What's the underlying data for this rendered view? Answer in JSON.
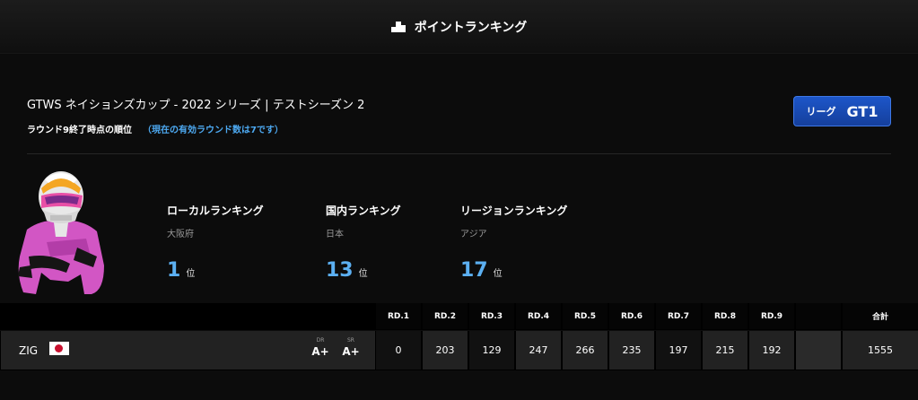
{
  "header": {
    "title": "ポイントランキング",
    "icon": "podium-icon"
  },
  "event": {
    "title": "GTWS ネイションズカップ - 2022 シリーズ | テストシーズン 2",
    "round_status": "ラウンド9終了時点の順位",
    "valid_rounds": "（現在の有効ラウンド数は7です）"
  },
  "league": {
    "label": "リーグ",
    "value": "GT1"
  },
  "rankings": [
    {
      "title": "ローカルランキング",
      "region": "大阪府",
      "rank": "1",
      "unit": "位"
    },
    {
      "title": "国内ランキング",
      "region": "日本",
      "rank": "13",
      "unit": "位"
    },
    {
      "title": "リージョンランキング",
      "region": "アジア",
      "rank": "17",
      "unit": "位"
    }
  ],
  "table": {
    "headers": [
      "RD.1",
      "RD.2",
      "RD.3",
      "RD.4",
      "RD.5",
      "RD.6",
      "RD.7",
      "RD.8",
      "RD.9",
      "",
      "合計"
    ],
    "row": {
      "name": "ZIG",
      "flag": "japan-flag",
      "dr_label": "DR",
      "dr_value": "A+",
      "sr_label": "SR",
      "sr_value": "A+",
      "scores": [
        "0",
        "203",
        "129",
        "247",
        "266",
        "235",
        "197",
        "215",
        "192",
        ""
      ],
      "total": "1555"
    }
  },
  "colors": {
    "accent_blue": "#5cb0f2",
    "league_badge": "#1d56c9",
    "background": "#0c0c0c"
  }
}
